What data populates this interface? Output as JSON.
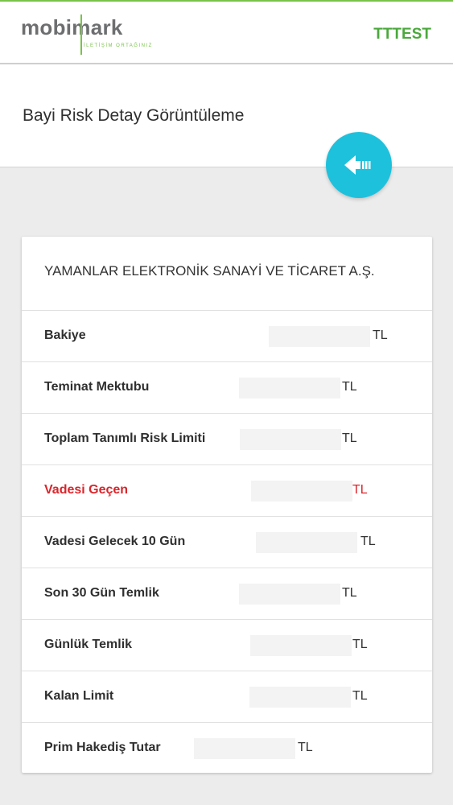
{
  "header": {
    "logo_text": "mobimark",
    "logo_sub": "İLETİŞİM ORTAĞINIZ",
    "user": "TTTEST",
    "brand_green": "#79c24a"
  },
  "page": {
    "title": "Bayi Risk Detay Görüntüleme",
    "back_icon": "back-arrow-icon",
    "fab_color": "#1ec1dc"
  },
  "card": {
    "company": "YAMANLAR ELEKTRONİK SANAYİ VE TİCARET A.Ş.",
    "rows": [
      {
        "label": "Bakiye",
        "value": "",
        "currency": "TL"
      },
      {
        "label": "Teminat Mektubu",
        "value": "",
        "currency": "TL"
      },
      {
        "label": "Toplam Tanımlı Risk Limiti",
        "value": "",
        "currency": "TL"
      },
      {
        "label": "Vadesi Geçen",
        "value": "",
        "currency": "TL",
        "alert": true
      },
      {
        "label": "Vadesi Gelecek 10 Gün",
        "value": "",
        "currency": "TL"
      },
      {
        "label": "Son 30 Gün Temlik",
        "value": "",
        "currency": "TL"
      },
      {
        "label": "Günlük Temlik",
        "value": "",
        "currency": "TL"
      },
      {
        "label": "Kalan Limit",
        "value": "",
        "currency": "TL"
      },
      {
        "label": "Prim Hakediş Tutar",
        "value": "",
        "currency": "TL"
      }
    ]
  }
}
